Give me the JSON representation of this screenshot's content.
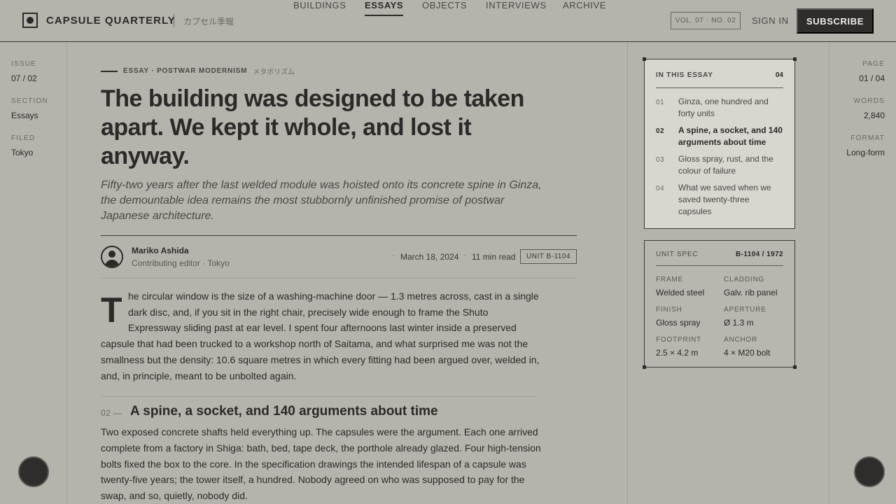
{
  "header": {
    "brand": "CAPSULE QUARTERLY",
    "brand_jp": "カプセル季報",
    "nav": [
      {
        "label": "BUILDINGS",
        "active": false
      },
      {
        "label": "ESSAYS",
        "active": true
      },
      {
        "label": "OBJECTS",
        "active": false
      },
      {
        "label": "INTERVIEWS",
        "active": false
      },
      {
        "label": "ARCHIVE",
        "active": false
      }
    ],
    "volume": "VOL. 07 · NO. 02",
    "sign_in": "SIGN IN",
    "subscribe": "SUBSCRIBE"
  },
  "left_rail": {
    "issue_label": "ISSUE",
    "issue_value": "07 / 02",
    "section_label": "SECTION",
    "section_value": "Essays",
    "filed_label": "FILED",
    "filed_value": "Tokyo"
  },
  "right_rail": {
    "page_label": "PAGE",
    "page_value": "01 / 04",
    "words_label": "WORDS",
    "words_value": "2,840",
    "format_label": "FORMAT",
    "format_value": "Long-form"
  },
  "article": {
    "kicker": "ESSAY · POSTWAR MODERNISM",
    "kicker_jp": "メタボリズム",
    "headline": "The building was designed to be taken apart. We kept it whole, and lost it anyway.",
    "dek": "Fifty-two years after the last welded module was hoisted onto its concrete spine in Ginza, the demountable idea remains the most stubbornly unfinished promise of postwar Japanese architecture.",
    "author_name": "Mariko Ashida",
    "author_role": "Contributing editor · Tokyo",
    "date": "March 18, 2024",
    "read_time": "11 min read",
    "unit_tag": "UNIT B-1104",
    "dropcap": "T",
    "intro_lines": [
      "he circular window is the size of a washing-machine door — 1.3 metres across, cast in a single",
      "dark disc, and, if you sit in the right chair, precisely wide enough to frame the Shuto",
      "Expressway sliding past at ear level. I spent four afternoons last winter inside a preserved",
      "capsule that had been trucked to a workshop north of Saitama, and what surprised me was not the",
      "smallness but the density: 10.6 square metres in which every fitting had been argued over, welded in,",
      "and, in principle, meant to be unbolted again."
    ],
    "section_num": "02 —",
    "section_title": "A spine, a socket, and 140 arguments about time",
    "section_lines": [
      "Two exposed concrete shafts held everything up. The capsules were the argument. Each one arrived",
      "complete from a factory in Shiga: bath, bed, tape deck, the porthole already glazed. Four high-tension",
      "bolts fixed the box to the core. In the specification drawings the intended lifespan of a capsule was",
      "twenty-five years; the tower itself, a hundred. Nobody agreed on who was supposed to pay for the",
      "swap, and so, quietly, nobody did."
    ]
  },
  "toc": {
    "heading": "IN THIS ESSAY",
    "count": "04",
    "items": [
      {
        "num": "01",
        "title": "Ginza, one hundred and forty units",
        "active": false
      },
      {
        "num": "02",
        "title": "A spine, a socket, and 140 arguments about time",
        "active": true
      },
      {
        "num": "03",
        "title": "Gloss spray, rust, and the colour of failure",
        "active": false
      },
      {
        "num": "04",
        "title": "What we saved when we saved twenty-three capsules",
        "active": false
      }
    ]
  },
  "spec": {
    "heading": "UNIT SPEC",
    "id": "B-1104 / 1972",
    "rows": [
      {
        "label": "FRAME",
        "value": "Welded steel"
      },
      {
        "label": "CLADDING",
        "value": "Galv. rib panel"
      },
      {
        "label": "FINISH",
        "value": "Gloss spray"
      },
      {
        "label": "APERTURE",
        "value": "Ø 1.3 m"
      },
      {
        "label": "FOOTPRINT",
        "value": "2.5 × 4.2 m"
      },
      {
        "label": "ANCHOR",
        "value": "4 × M20 bolt"
      }
    ]
  },
  "icons": {
    "logo": "capsule-logo-icon",
    "avatar": "person-icon"
  },
  "colors": {
    "background": "#b6b3ad",
    "ink": "#2b2a28",
    "button": "#2e2d2b",
    "card": "#d9d6d0"
  }
}
